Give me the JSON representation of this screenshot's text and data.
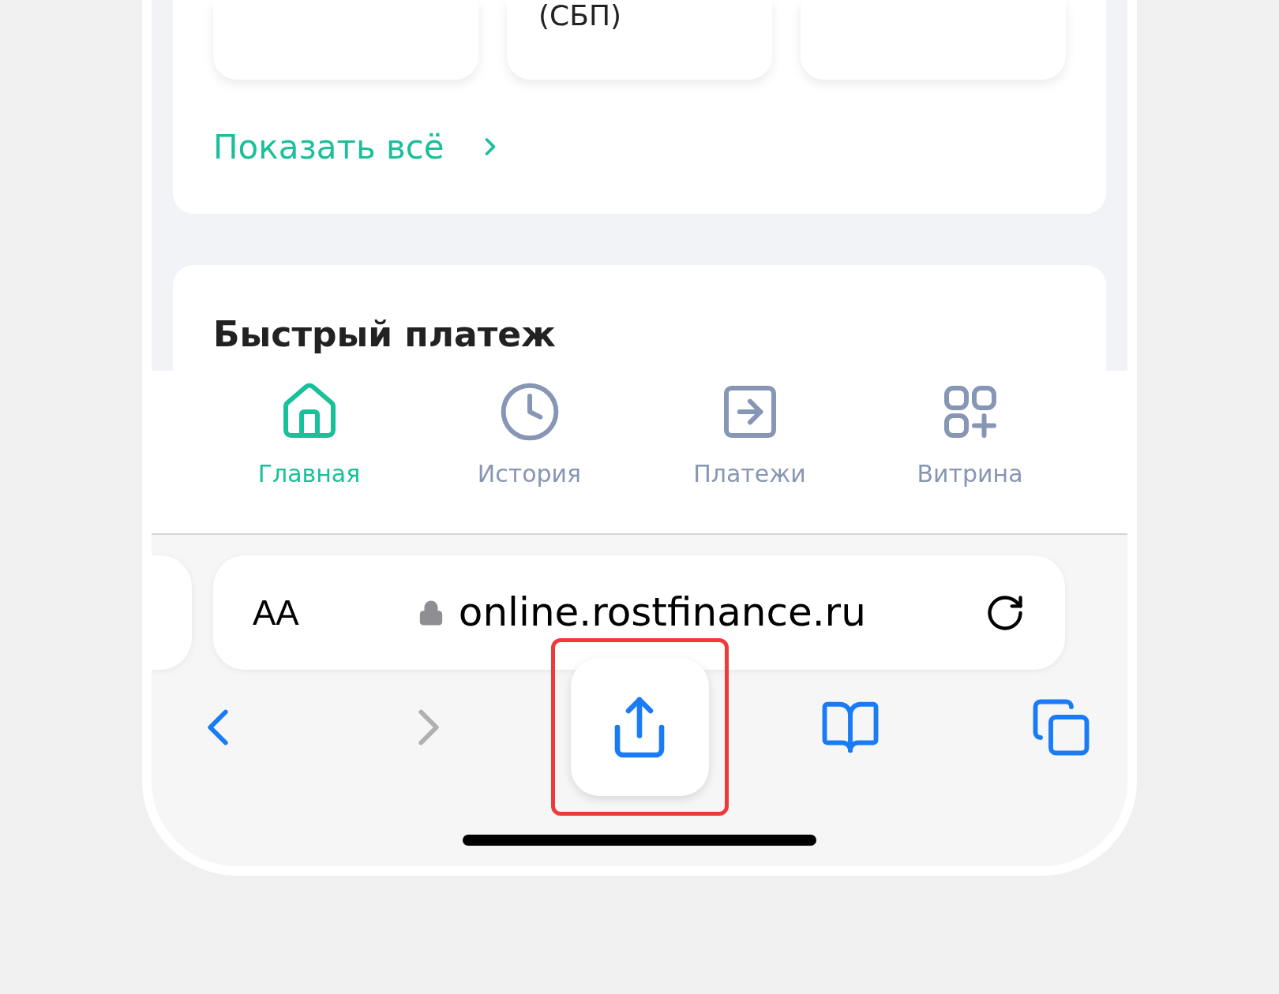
{
  "top_card_label": "(СБП)",
  "show_all_link": "Показать всё",
  "section_heading": "Быстрый платеж",
  "tabs": [
    {
      "label": "Главная",
      "selected": true
    },
    {
      "label": "История",
      "selected": false
    },
    {
      "label": "Платежи",
      "selected": false
    },
    {
      "label": "Витрина",
      "selected": false
    }
  ],
  "address_bar": {
    "text_size_button": "AA",
    "url": "online.rostfinance.ru"
  },
  "toolbar": [
    {
      "disabled": false,
      "highlighted": false
    },
    {
      "disabled": true,
      "highlighted": false
    },
    {
      "disabled": false,
      "highlighted": true
    },
    {
      "disabled": false,
      "highlighted": false
    },
    {
      "disabled": false,
      "highlighted": false
    }
  ]
}
